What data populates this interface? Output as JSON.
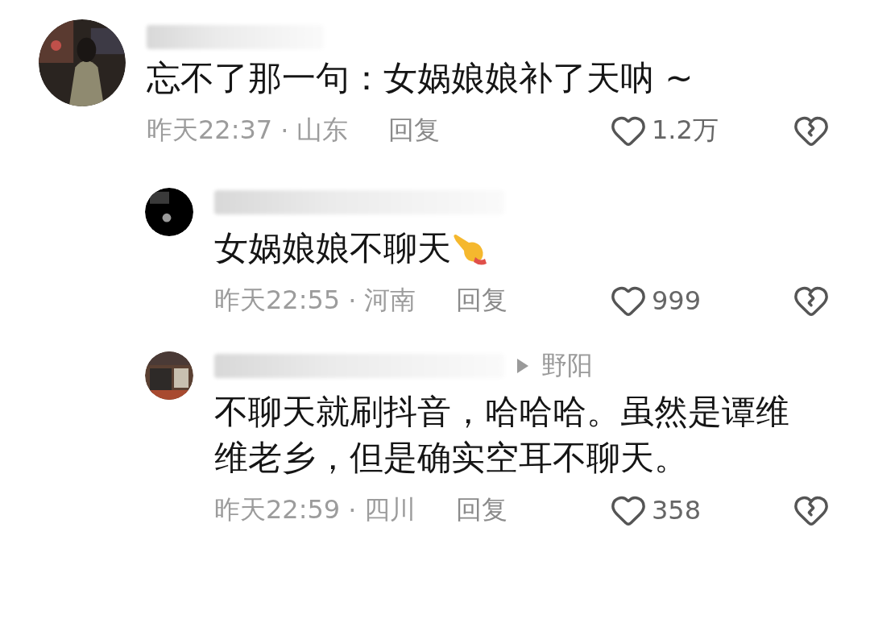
{
  "comments": [
    {
      "author": {
        "kind": "redacted"
      },
      "text": "忘不了那一句：女娲娘娘补了天呐 ~",
      "time": "昨天22:37",
      "separator": "·",
      "location": "山东",
      "reply_label": "回复",
      "likes": "1.2万",
      "children": [
        {
          "author": {
            "kind": "redacted"
          },
          "text": "女娲娘娘不聊天",
          "emoji": {
            "kind": "pointing_hand"
          },
          "time": "昨天22:55",
          "separator": "·",
          "location": "河南",
          "reply_label": "回复",
          "likes": "999"
        },
        {
          "author": {
            "kind": "redacted",
            "reply_to": "野阳"
          },
          "text": "不聊天就刷抖音，哈哈哈。虽然是谭维维老乡，但是确实空耳不聊天。",
          "time": "昨天22:59",
          "separator": "·",
          "location": "四川",
          "reply_label": "回复",
          "likes": "358"
        }
      ]
    }
  ]
}
